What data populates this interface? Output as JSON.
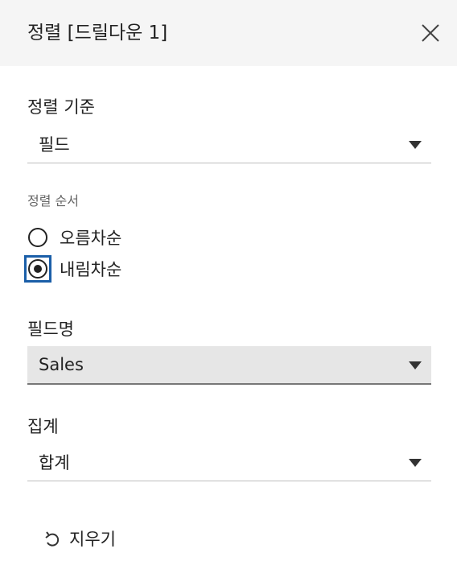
{
  "dialog": {
    "title": "정렬 [드릴다운 1]"
  },
  "sort_by": {
    "label": "정렬 기준",
    "value": "필드"
  },
  "sort_order": {
    "label": "정렬 순서",
    "options": [
      {
        "label": "오름차순",
        "checked": false
      },
      {
        "label": "내림차순",
        "checked": true
      }
    ]
  },
  "field_name": {
    "label": "필드명",
    "value": "Sales"
  },
  "aggregation": {
    "label": "집계",
    "value": "합계"
  },
  "actions": {
    "clear_label": "지우기"
  },
  "icons": {
    "close": "close-icon",
    "clear": "undo-icon",
    "dropdown": "caret-down-icon"
  },
  "colors": {
    "header_bg": "#f5f5f5",
    "focus_ring": "#1a5ea8",
    "filled_dropdown_bg": "#e6e6e6"
  }
}
